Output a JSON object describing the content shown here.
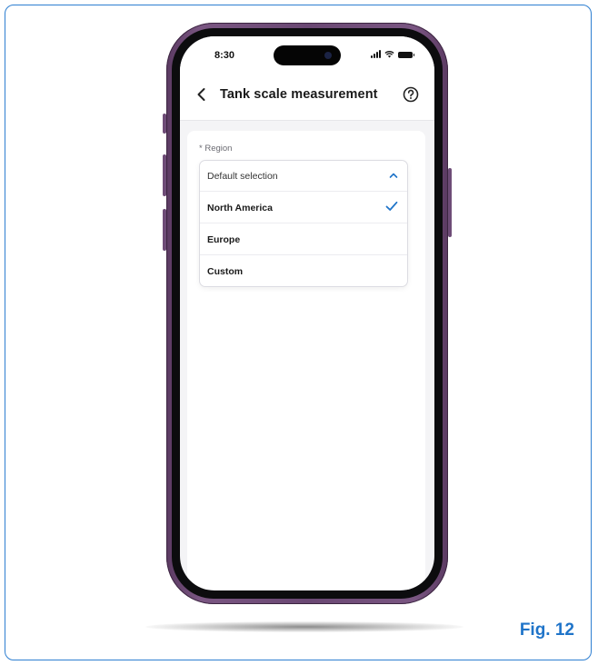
{
  "figure": {
    "label": "Fig. 12"
  },
  "status_bar": {
    "time": "8:30"
  },
  "header": {
    "title": "Tank scale measurement",
    "back_icon": "chevron-left-icon",
    "help_icon": "question-circle-icon"
  },
  "form": {
    "region_label": "* Region",
    "dropdown": {
      "placeholder": "Default selection",
      "expanded": true,
      "options": [
        {
          "label": "North America",
          "selected": true
        },
        {
          "label": "Europe",
          "selected": false
        },
        {
          "label": "Custom",
          "selected": false
        }
      ]
    }
  },
  "colors": {
    "accent": "#1f74c9",
    "phone_frame": "#6a4873",
    "figure_border": "#2e7fd1"
  }
}
